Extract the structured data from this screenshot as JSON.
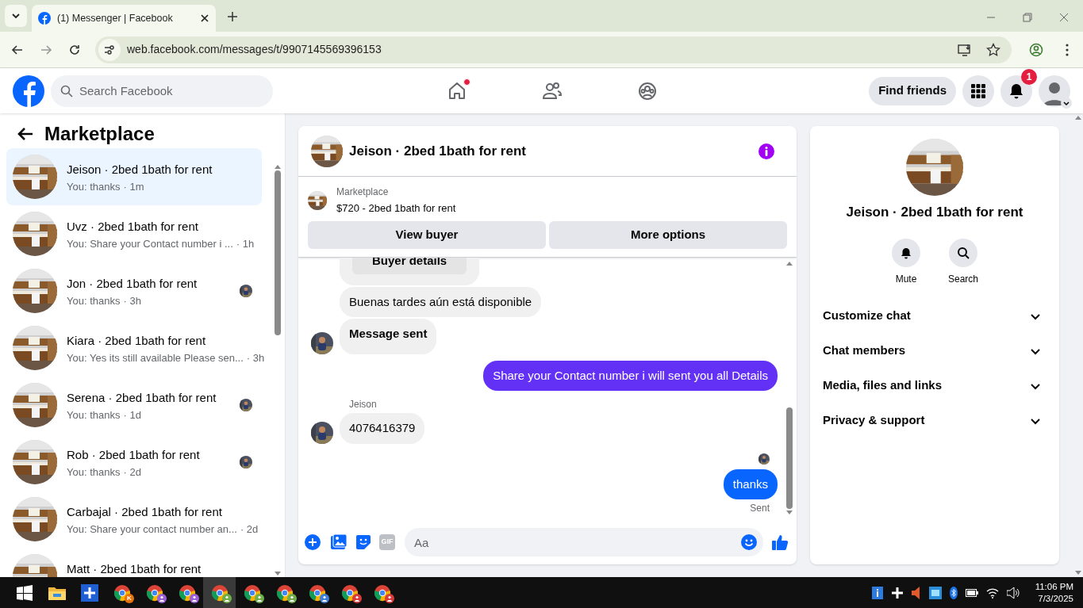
{
  "browser": {
    "tab_title": "(1) Messenger | Facebook",
    "url": "web.facebook.com/messages/t/9907145569396153"
  },
  "header": {
    "search_placeholder": "Search Facebook",
    "nav": [
      {
        "kind": "home",
        "dot": true
      },
      {
        "kind": "friends",
        "dot": false
      },
      {
        "kind": "groups",
        "dot": false
      }
    ],
    "find_friends": "Find friends",
    "notification_count": "1"
  },
  "sidebar": {
    "title": "Marketplace",
    "conversations": [
      {
        "name": "Jeison · 2bed 1bath for rent",
        "preview": "You: thanks",
        "time": "· 1m",
        "selected": true,
        "seen": false
      },
      {
        "name": "Uvz · 2bed 1bath for rent",
        "preview": "You: Share your Contact number i ...",
        "time": " · 1h",
        "selected": false,
        "seen": false
      },
      {
        "name": "Jon · 2bed 1bath for rent",
        "preview": "You: thanks",
        "time": "· 3h",
        "selected": false,
        "seen": true
      },
      {
        "name": "Kiara · 2bed 1bath for rent",
        "preview": "You: Yes its still available Please sen...",
        "time": "· 3h",
        "selected": false,
        "seen": false
      },
      {
        "name": "Serena · 2bed 1bath for rent",
        "preview": "You: thanks",
        "time": "· 1d",
        "selected": false,
        "seen": true
      },
      {
        "name": "Rob · 2bed 1bath for rent",
        "preview": "You: thanks",
        "time": "· 2d",
        "selected": false,
        "seen": true
      },
      {
        "name": "Carbajal · 2bed 1bath for rent",
        "preview": "You: Share your contact number an...",
        "time": "· 2d",
        "selected": false,
        "seen": false
      },
      {
        "name": "Matt · 2bed 1bath for rent",
        "selected": false,
        "seen": false
      }
    ]
  },
  "chat": {
    "title": "Jeison · 2bed 1bath for rent",
    "listing_label": "Marketplace",
    "listing_title": "$720 - 2bed 1bath for rent",
    "buttons": [
      "View buyer",
      "More options"
    ],
    "messages": [
      {
        "kind": "card",
        "button": "Buyer details"
      },
      {
        "kind": "incoming",
        "text": "Buenas tardes aún está disponible",
        "avatar": false,
        "bold": false
      },
      {
        "kind": "incoming",
        "text": "Message sent",
        "avatar": true,
        "bold": true
      },
      {
        "kind": "outgoing",
        "text": "Share your Contact number i will sent you all Details",
        "color": "#6331f5"
      },
      {
        "kind": "incoming",
        "sender": "Jeison",
        "text": "4076416379",
        "avatar": true,
        "bold": false
      },
      {
        "kind": "seen"
      },
      {
        "kind": "outgoing",
        "text": "thanks",
        "color": "#0866ff",
        "status": "Sent"
      }
    ],
    "composer": {
      "gif": "GIF",
      "placeholder": "Aa"
    }
  },
  "details": {
    "name": "Jeison · 2bed 1bath for rent",
    "actions": [
      {
        "kind": "mute",
        "label": "Mute"
      },
      {
        "kind": "search",
        "label": "Search"
      }
    ],
    "sections": [
      {
        "label": "Customize chat",
        "expanded": false
      },
      {
        "label": "Chat members",
        "expanded": false
      },
      {
        "label": "Media, files and links",
        "expanded": false
      },
      {
        "label": "Privacy & support",
        "expanded": false
      }
    ]
  },
  "taskbar": {
    "apps": [
      {
        "kind": "start"
      },
      {
        "kind": "folder"
      },
      {
        "kind": "plus"
      },
      {
        "kind": "browser",
        "color": "#e8710a",
        "badge": "K",
        "selected": false
      },
      {
        "kind": "browser",
        "color": "#9c5fd6",
        "selected": false
      },
      {
        "kind": "browser",
        "color": "#9c5fd6",
        "selected": false
      },
      {
        "kind": "browser",
        "color": "#6fae4a",
        "selected": true
      },
      {
        "kind": "browser",
        "color": "#6fae4a",
        "selected": false
      },
      {
        "kind": "browser",
        "color": "#6fae4a",
        "selected": false
      },
      {
        "kind": "browser",
        "color": "#3d7fd8",
        "selected": false
      },
      {
        "kind": "browser",
        "color": "#d93a3a",
        "selected": false
      },
      {
        "kind": "browser",
        "color": "#d93a3a",
        "selected": false
      }
    ],
    "time": "11:06 PM",
    "date": "7/3/2025"
  }
}
